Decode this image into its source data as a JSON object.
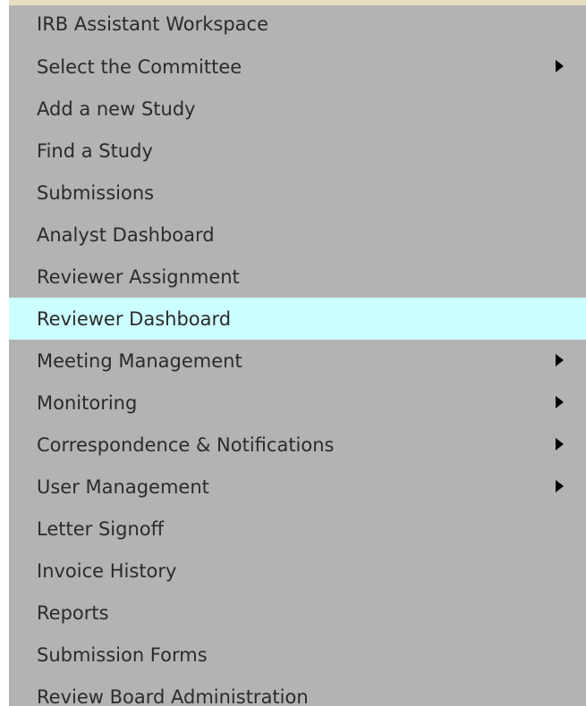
{
  "menu": {
    "items": [
      {
        "label": "IRB Assistant Workspace",
        "has_submenu": false
      },
      {
        "label": "Select the Committee",
        "has_submenu": true
      },
      {
        "label": "Add a new Study",
        "has_submenu": false
      },
      {
        "label": "Find a Study",
        "has_submenu": false
      },
      {
        "label": "Submissions",
        "has_submenu": false
      },
      {
        "label": "Analyst Dashboard",
        "has_submenu": false
      },
      {
        "label": "Reviewer Assignment",
        "has_submenu": false
      },
      {
        "label": "Reviewer Dashboard",
        "has_submenu": false,
        "highlighted": true
      },
      {
        "label": "Meeting Management",
        "has_submenu": true
      },
      {
        "label": "Monitoring",
        "has_submenu": true
      },
      {
        "label": "Correspondence & Notifications",
        "has_submenu": true
      },
      {
        "label": "User Management",
        "has_submenu": true
      },
      {
        "label": "Letter Signoff",
        "has_submenu": false
      },
      {
        "label": "Invoice History",
        "has_submenu": false
      },
      {
        "label": "Reports",
        "has_submenu": false
      },
      {
        "label": "Submission Forms",
        "has_submenu": false
      },
      {
        "label": "Review Board Administration",
        "has_submenu": false
      }
    ]
  },
  "colors": {
    "menu_background": "#b3b3b3",
    "highlight_background": "#ccffff",
    "text": "#2b2b2b",
    "arrow": "#000000"
  },
  "icons": {
    "submenu_indicator": "caret-right-icon"
  }
}
